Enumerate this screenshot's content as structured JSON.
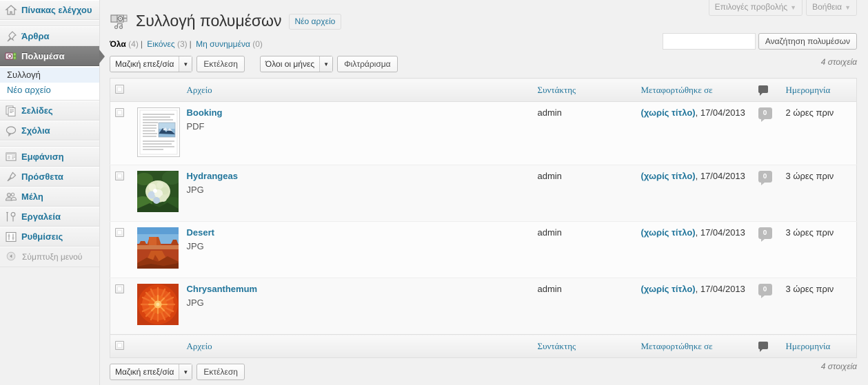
{
  "sidebar": {
    "items": [
      {
        "label": "Πίνακας ελέγχου",
        "icon": "dashboard-icon",
        "current": false
      },
      {
        "label": "Άρθρα",
        "icon": "posts-pin-icon",
        "current": false
      },
      {
        "label": "Πολυμέσα",
        "icon": "media-camera-icon",
        "current": true
      },
      {
        "label": "Σελίδες",
        "icon": "pages-icon",
        "current": false
      },
      {
        "label": "Σχόλια",
        "icon": "comments-icon",
        "current": false
      },
      {
        "label": "Εμφάνιση",
        "icon": "appearance-icon",
        "current": false
      },
      {
        "label": "Πρόσθετα",
        "icon": "plugins-plug-icon",
        "current": false
      },
      {
        "label": "Μέλη",
        "icon": "users-icon",
        "current": false
      },
      {
        "label": "Εργαλεία",
        "icon": "tools-icon",
        "current": false
      },
      {
        "label": "Ρυθμίσεις",
        "icon": "settings-icon",
        "current": false
      }
    ],
    "submenu": [
      {
        "label": "Συλλογή",
        "current": true
      },
      {
        "label": "Νέο αρχείο",
        "current": false
      }
    ],
    "collapse": {
      "label": "Σύμπτυξη μενού",
      "icon": "collapse-arrow-icon"
    }
  },
  "screen_meta": {
    "screen_options": "Επιλογές προβολής",
    "help": "Βοήθεια",
    "caret": "▼"
  },
  "header": {
    "title": "Συλλογή πολυμέσων",
    "title_icon": "media-camera-icon",
    "add_new": "Νέο αρχείο"
  },
  "search": {
    "value": "",
    "placeholder": "",
    "button": "Αναζήτηση πολυμέσων"
  },
  "filters": {
    "links": [
      {
        "label": "Όλα",
        "count": "(4)",
        "current": true
      },
      {
        "label": "Εικόνες",
        "count": "(3)",
        "current": false
      },
      {
        "label": "Μη συνημμένα",
        "count": "(0)",
        "current": false
      }
    ],
    "divider": "|"
  },
  "tablenav_top": {
    "bulk_action": "Μαζική επεξ/σία",
    "apply": "Εκτέλεση",
    "months": "Όλοι οι μήνες",
    "filter": "Φιλτράρισμα",
    "count": "4 στοιχεία",
    "arrow": "▼"
  },
  "tablenav_bottom": {
    "bulk_action": "Μαζική επεξ/σία",
    "apply": "Εκτέλεση",
    "count": "4 στοιχεία",
    "arrow": "▼"
  },
  "table": {
    "columns": {
      "file": "Αρχείο",
      "author": "Συντάκτης",
      "parent": "Μεταφορτώθηκε σε",
      "comments_icon": "comment-bubble-icon",
      "date": "Ημερομηνία"
    },
    "rows": [
      {
        "title": "Booking",
        "type": "PDF",
        "thumb": "document-preview-thumb",
        "author": "admin",
        "parent_link": "(χωρίς τίτλο)",
        "parent_date": ", 17/04/2013",
        "comments": "0",
        "date": "2 ώρες πριν"
      },
      {
        "title": "Hydrangeas",
        "type": "JPG",
        "thumb": "hydrangeas-thumb",
        "author": "admin",
        "parent_link": "(χωρίς τίτλο)",
        "parent_date": ", 17/04/2013",
        "comments": "0",
        "date": "3 ώρες πριν"
      },
      {
        "title": "Desert",
        "type": "JPG",
        "thumb": "desert-thumb",
        "author": "admin",
        "parent_link": "(χωρίς τίτλο)",
        "parent_date": ", 17/04/2013",
        "comments": "0",
        "date": "3 ώρες πριν"
      },
      {
        "title": "Chrysanthemum",
        "type": "JPG",
        "thumb": "chrysanthemum-thumb",
        "author": "admin",
        "parent_link": "(χωρίς τίτλο)",
        "parent_date": ", 17/04/2013",
        "comments": "0",
        "date": "3 ώρες πριν"
      }
    ]
  },
  "colors": {
    "link": "#21759b",
    "sidebar_bg": "#f1f1f1",
    "current_menu_bg": "#777777",
    "submenu_current_bg": "#eaf2fa"
  }
}
